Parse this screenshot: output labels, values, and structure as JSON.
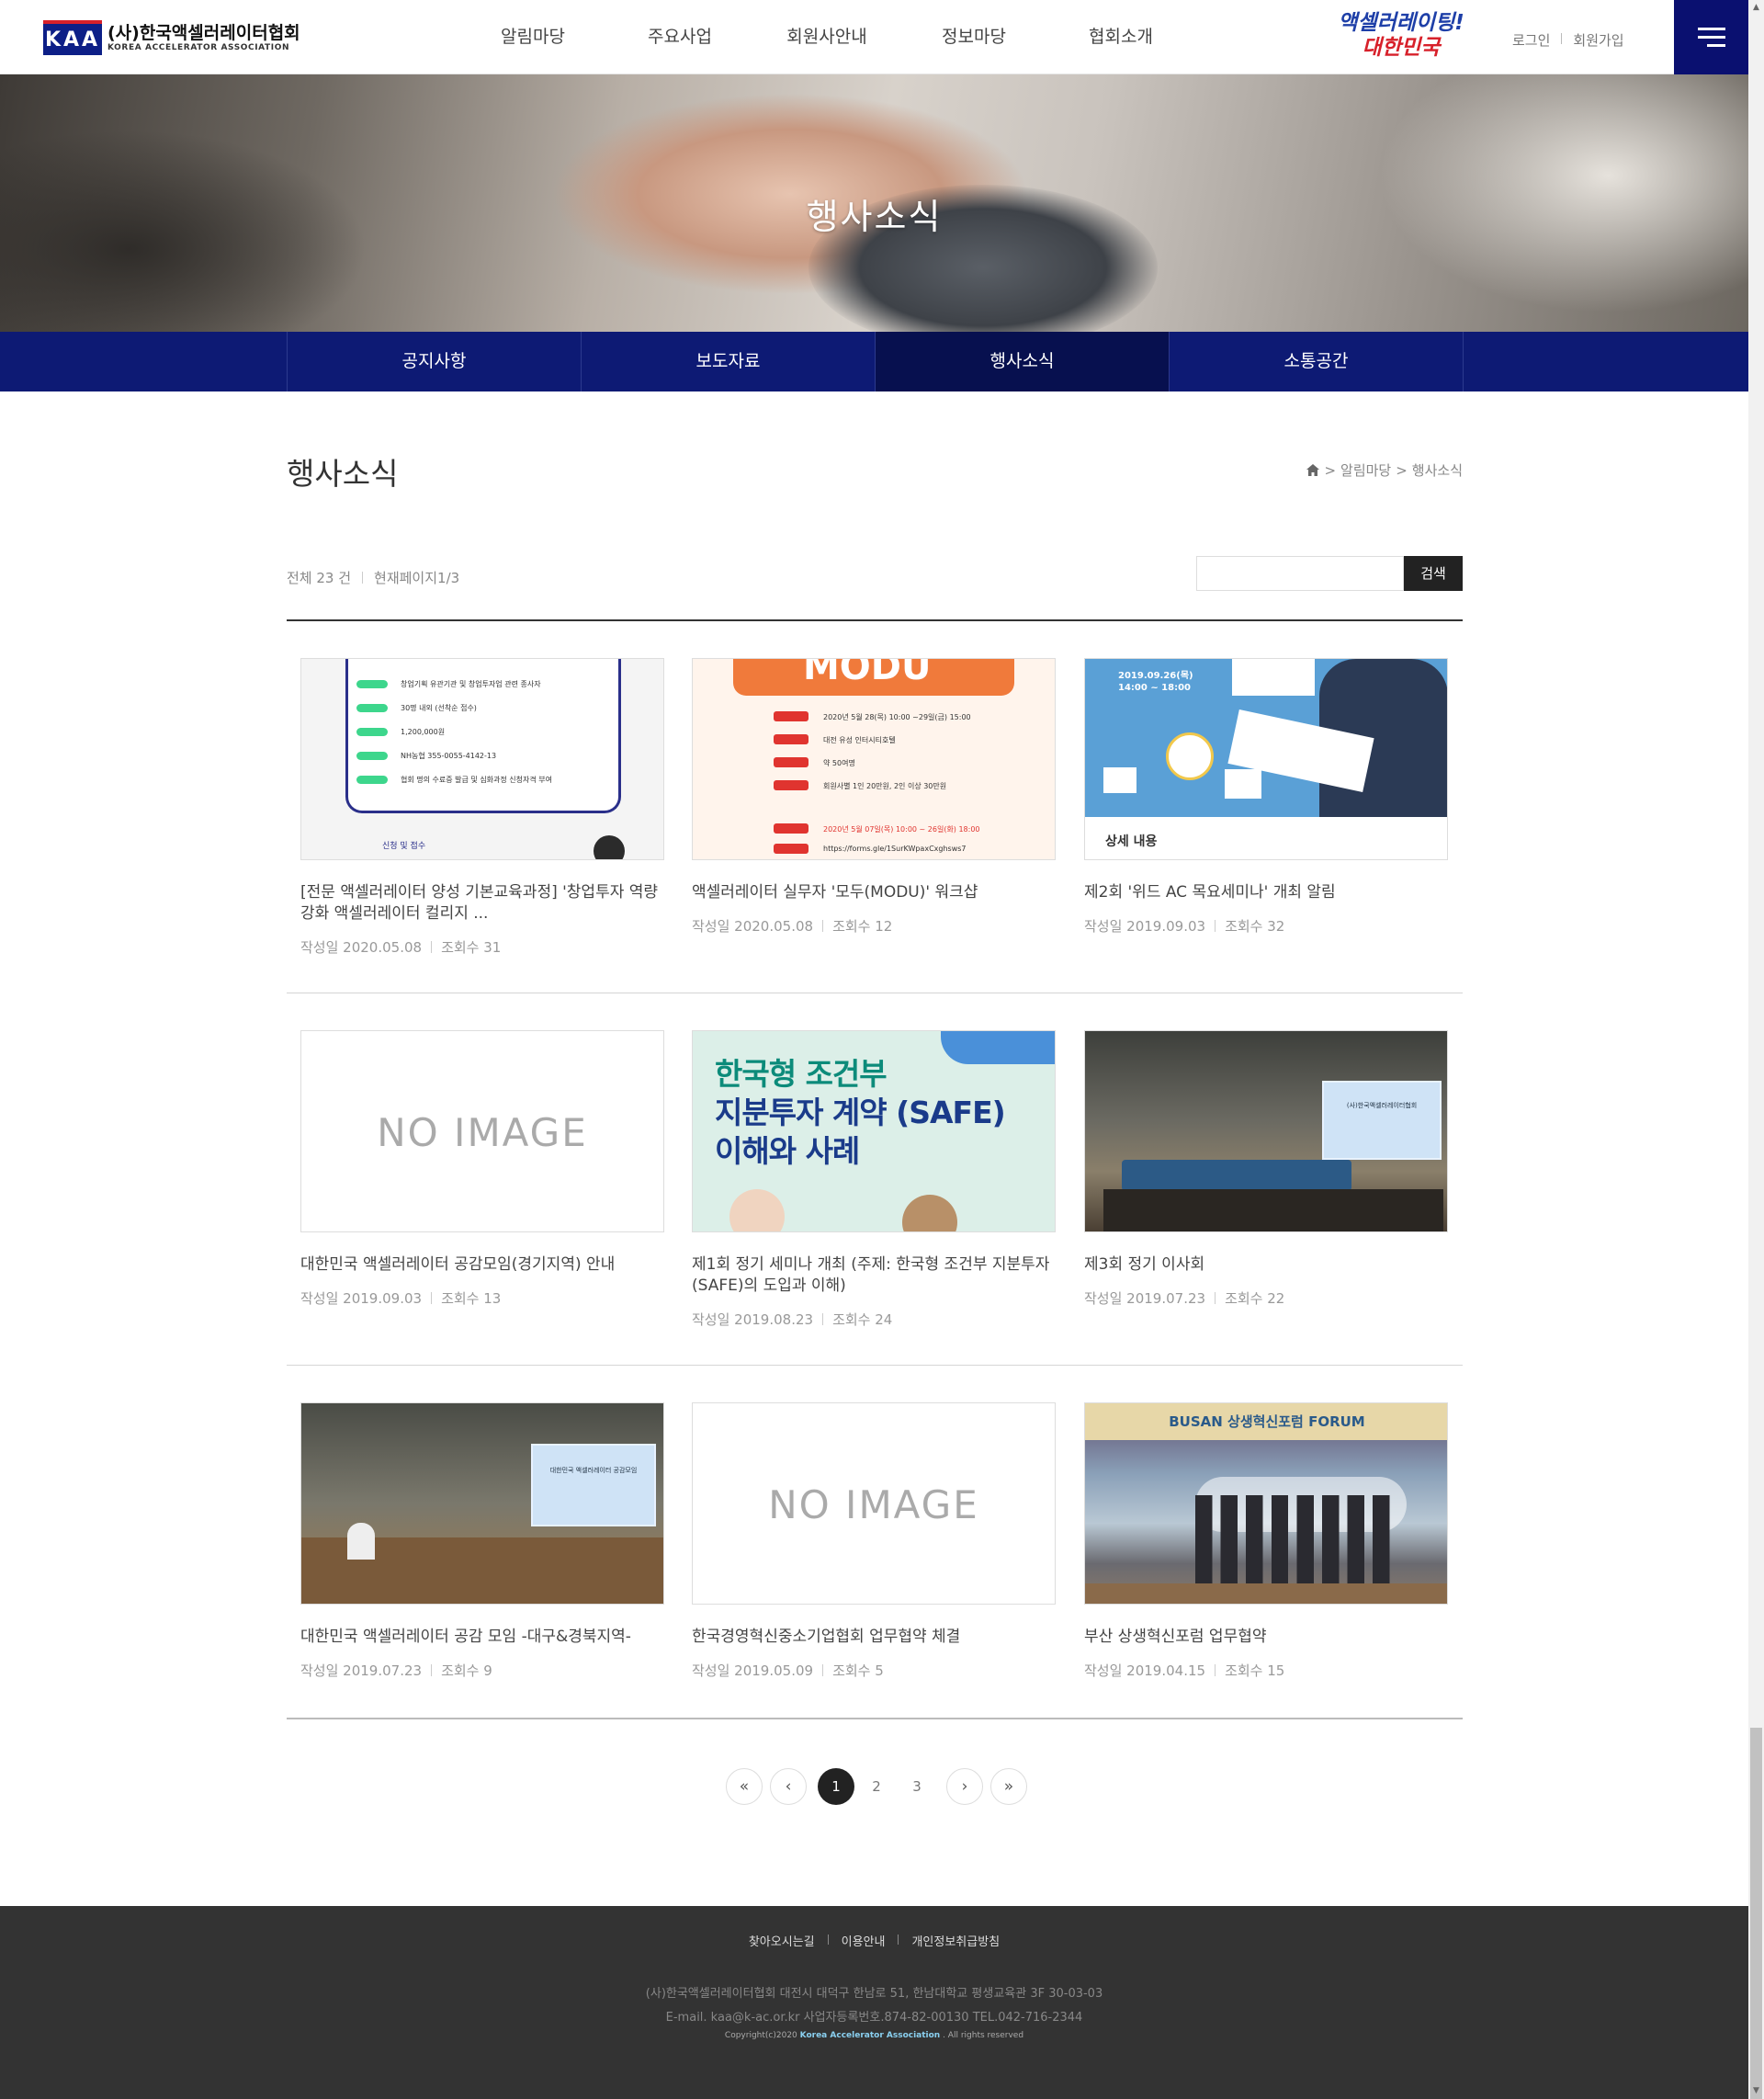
{
  "header": {
    "logo_mark": "KAA",
    "logo_name": "(사)한국액셀러레이터협회",
    "logo_sub": "KOREA ACCELERATOR ASSOCIATION",
    "nav": [
      "알림마당",
      "주요사업",
      "회원사안내",
      "정보마당",
      "협회소개"
    ],
    "slogan_line1": "액셀러레이팅!",
    "slogan_line2": "대한민국",
    "login": "로그인",
    "join": "회원가입",
    "menu_icon": "hamburger-icon"
  },
  "hero": {
    "title": "행사소식"
  },
  "subnav": {
    "items": [
      "공지사항",
      "보도자료",
      "행사소식",
      "소통공간"
    ],
    "active": "행사소식"
  },
  "content": {
    "title": "행사소식",
    "breadcrumb": [
      "알림마당",
      "행사소식"
    ],
    "total": "전체 23 건",
    "page_info": "현재페이지1/3",
    "search_placeholder": "",
    "search_button": "검색"
  },
  "posts": [
    {
      "title": "[전문 액셀러레이터 양성 기본교육과정] '창업투자 역량강화 액셀러레이터 컬리지 ...",
      "date": "작성일  2020.05.08",
      "views": "조회수  31",
      "thumb": "poster"
    },
    {
      "title": "액셀러레이터 실무자 '모두(MODU)' 워크샵",
      "date": "작성일  2020.05.08",
      "views": "조회수  12",
      "thumb": "poster"
    },
    {
      "title": "제2회 '위드 AC 목요세미나' 개최 알림",
      "date": "작성일  2019.09.03",
      "views": "조회수  32",
      "thumb": "poster"
    },
    {
      "title": "대한민국 액셀러레이터 공감모임(경기지역) 안내",
      "date": "작성일  2019.09.03",
      "views": "조회수  13",
      "thumb": "none"
    },
    {
      "title": "제1회 정기 세미나 개최 (주제: 한국형 조건부 지분투자(SAFE)의 도입과 이해)",
      "date": "작성일  2019.08.23",
      "views": "조회수  24",
      "thumb": "poster"
    },
    {
      "title": "제3회 정기 이사회",
      "date": "작성일  2019.07.23",
      "views": "조회수  22",
      "thumb": "photo"
    },
    {
      "title": "대한민국 액셀러레이터 공감 모임 -대구&경북지역-",
      "date": "작성일  2019.07.23",
      "views": "조회수  9",
      "thumb": "photo"
    },
    {
      "title": "한국경영혁신중소기업협회 업무협약 체결",
      "date": "작성일  2019.05.09",
      "views": "조회수  5",
      "thumb": "none"
    },
    {
      "title": "부산 상생혁신포럼 업무협약",
      "date": "작성일  2019.04.15",
      "views": "조회수  15",
      "thumb": "photo"
    }
  ],
  "thumbs": {
    "no_image": "NO IMAGE",
    "poster1_rows": [
      "창업기획 유관기관 및 창업투자업 관련 종사자",
      "30명 내외 (선착순 접수)",
      "1,200,000원",
      "NH농협 355-0055-4142-13",
      "협회 명의 수료증 발급 및 심화과정 신청자격 부여",
      "신청 및 접수"
    ],
    "poster2_rows": [
      "2020년 5월 28(목) 10:00 ~29일(금) 15:00",
      "대전 유성 인터시티호텔",
      "약 50여명",
      "회원사별 1인 20만원, 2인 이상 30만원",
      "2020년 5월 07일(목) 10:00 ~ 26일(화) 18:00",
      "https://forms.gle/1SurKWpaxCxghsws7"
    ],
    "poster2_top": "MODU",
    "poster3_date": "2019.09.26(목)",
    "poster3_time": "14:00 ~ 18:00",
    "poster3_caption": "상세 내용",
    "poster4_line1": "한국형 조건부",
    "poster4_line2": "지분투자 계약 (SAFE)",
    "poster4_line3": "이해와 사례",
    "photo1_screen": "(사)한국액셀러레이터협회",
    "photo2_screen": "대한민국 액셀러레이터 공감모임",
    "photo3_banner": "BUSAN 상생혁신포럼 FORUM"
  },
  "pagination": {
    "first": "«",
    "prev": "‹",
    "pages": [
      "1",
      "2",
      "3"
    ],
    "current": "1",
    "next": "›",
    "last": "»"
  },
  "footer": {
    "links": [
      "찾아오시는길",
      "이용안내",
      "개인정보취급방침"
    ],
    "address": "(사)한국액셀러레이터협회 대전시 대덕구 한남로 51, 한남대학교 평생교육관 3F 30-03-03",
    "contact": "E-mail. kaa@k-ac.or.kr 사업자등록번호.874-82-00130 TEL.042-716-2344",
    "copyright_pre": "Copyright(c)2020 ",
    "copyright_name": "Korea  Accelerator Association",
    "copyright_post": " . All rights reserved"
  },
  "colors": {
    "navy": "#0d1a74",
    "menu_button": "#0a1070",
    "footer_bg": "#333333"
  }
}
